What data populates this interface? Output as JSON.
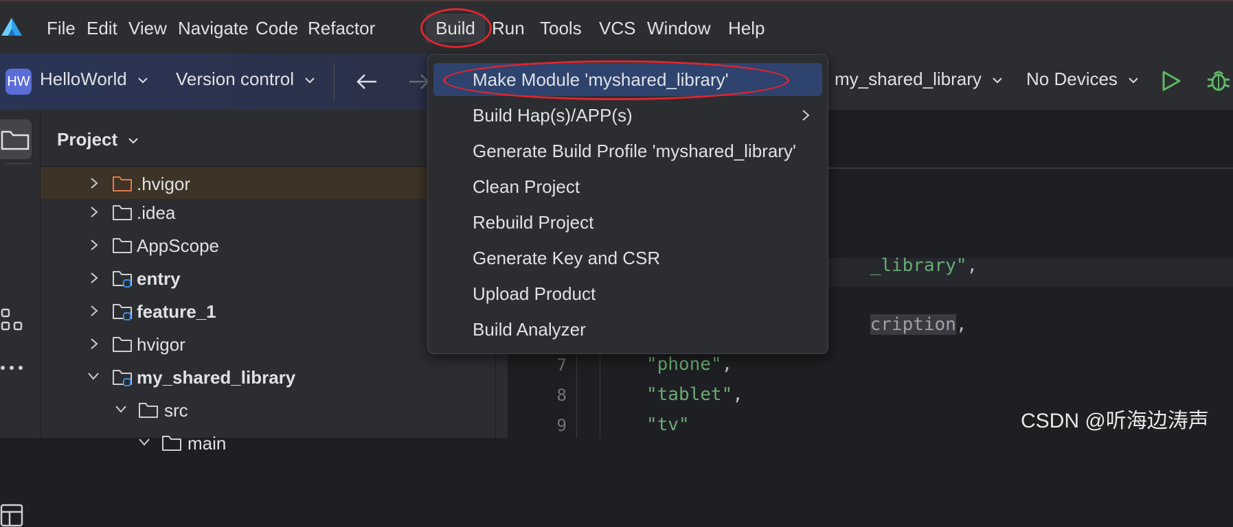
{
  "menubar": {
    "items": [
      {
        "label": "File"
      },
      {
        "label": "Edit"
      },
      {
        "label": "View"
      },
      {
        "label": "Navigate"
      },
      {
        "label": "Code"
      },
      {
        "label": "Refactor"
      },
      {
        "label": "Build"
      },
      {
        "label": "Run"
      },
      {
        "label": "Tools"
      },
      {
        "label": "VCS"
      },
      {
        "label": "Window"
      },
      {
        "label": "Help"
      }
    ],
    "active_item": "Build"
  },
  "toolbar": {
    "project_badge": "HW",
    "project_name": "HelloWorld",
    "version_control": "Version control",
    "module_selector": "my_shared_library",
    "device_selector": "No Devices"
  },
  "project_panel": {
    "title": "Project",
    "tree": [
      {
        "label": ".hvigor",
        "bold": false,
        "expanded": false
      },
      {
        "label": ".idea",
        "bold": false,
        "expanded": false
      },
      {
        "label": "AppScope",
        "bold": false,
        "expanded": false
      },
      {
        "label": "entry",
        "bold": true,
        "expanded": false
      },
      {
        "label": "feature_1",
        "bold": true,
        "expanded": false
      },
      {
        "label": "hvigor",
        "bold": false,
        "expanded": false
      },
      {
        "label": "my_shared_library",
        "bold": true,
        "expanded": true
      },
      {
        "label": "src",
        "bold": false,
        "expanded": true
      },
      {
        "label": "main",
        "bold": false,
        "expanded": true
      }
    ]
  },
  "editor": {
    "fragments": [
      {
        "text": "_library\"",
        "kind": "str"
      },
      {
        "text": ",",
        "kind": "punc"
      },
      {
        "text": "cription",
        "kind": "punc"
      },
      {
        "text": ",",
        "kind": "punc"
      }
    ],
    "lines": [
      {
        "number": "7",
        "text": "\"phone\"",
        "trail": ","
      },
      {
        "number": "8",
        "text": "\"tablet\"",
        "trail": ","
      },
      {
        "number": "9",
        "text": "\"tv\"",
        "trail": ""
      }
    ]
  },
  "build_menu": {
    "items": [
      {
        "label": "Make Module 'myshared_library'",
        "selected": true,
        "submenu": false
      },
      {
        "label": "Build Hap(s)/APP(s)",
        "selected": false,
        "submenu": true
      },
      {
        "label": "Generate Build Profile 'myshared_library'",
        "selected": false,
        "submenu": false
      },
      {
        "label": "Clean Project",
        "selected": false,
        "submenu": false
      },
      {
        "label": "Rebuild Project",
        "selected": false,
        "submenu": false
      },
      {
        "label": "Generate Key and CSR",
        "selected": false,
        "submenu": false
      },
      {
        "label": "Upload Product",
        "selected": false,
        "submenu": false
      },
      {
        "label": "Build Analyzer",
        "selected": false,
        "submenu": false
      }
    ]
  },
  "watermark": "CSDN @听海边涛声",
  "icons": {
    "app_logo": "deveco-logo-icon",
    "back": "arrow-left-icon",
    "forward": "arrow-right-icon",
    "run": "run-icon",
    "debug": "debug-icon",
    "project_tool": "folder-icon",
    "structure_tool": "structure-icon",
    "more_tools": "more-icon",
    "layout_tool": "table-icon"
  },
  "colors": {
    "background": "#1e1f22",
    "panel": "#2b2d30",
    "selection": "#2e436e",
    "annotation_red": "#e0252e",
    "string_green": "#6aab73",
    "run_green": "#5fb865"
  }
}
